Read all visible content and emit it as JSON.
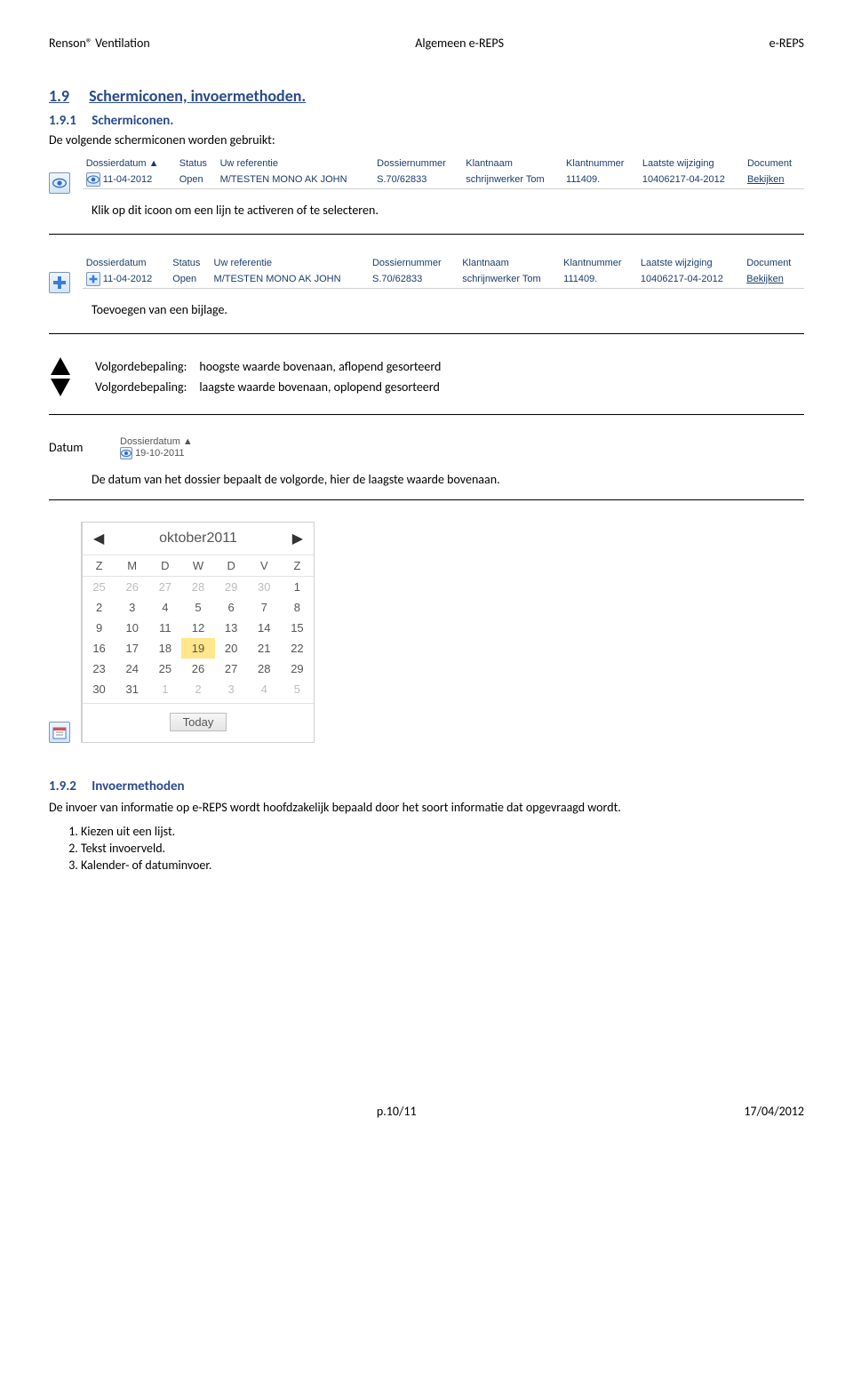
{
  "header": {
    "left": "Renson® Ventilation",
    "center": "Algemeen e-REPS",
    "right": "e-REPS"
  },
  "footer": {
    "center": "p.10/11",
    "right": "17/04/2012"
  },
  "section": {
    "num": "1.9",
    "title": "Schermiconen, invoermethoden."
  },
  "sub1": {
    "num": "1.9.1",
    "title": "Schermiconen."
  },
  "sub1desc": "De volgende schermiconen worden gebruikt:",
  "table1": {
    "headers": [
      "Dossierdatum ▲",
      "Status",
      "Uw referentie",
      "Dossiernummer",
      "Klantnaam",
      "Klantnummer",
      "Laatste wijziging",
      "Document"
    ],
    "row": [
      "11-04-2012",
      "Open",
      "M/TESTEN MONO AK JOHN",
      "S.70/62833",
      "schrijnwerker Tom",
      "111409.",
      "10406217-04-2012",
      "Bekijken"
    ]
  },
  "caption1": "Klik op dit icoon om een lijn te activeren of te selecteren.",
  "table2": {
    "headers": [
      "Dossierdatum",
      "Status",
      "Uw referentie",
      "Dossiernummer",
      "Klantnaam",
      "Klantnummer",
      "Laatste wijziging",
      "Document"
    ],
    "row": [
      "11-04-2012",
      "Open",
      "M/TESTEN MONO AK JOHN",
      "S.70/62833",
      "schrijnwerker Tom",
      "111409.",
      "10406217-04-2012",
      "Bekijken"
    ]
  },
  "caption2": "Toevoegen van een bijlage.",
  "sort": {
    "rows": [
      [
        "Volgordebepaling:",
        "hoogste waarde bovenaan, aflopend gesorteerd"
      ],
      [
        "Volgordebepaling:",
        "laagste waarde bovenaan, oplopend gesorteerd"
      ]
    ]
  },
  "datum": {
    "label": "Datum",
    "mini_header": "Dossierdatum ▲",
    "mini_value": "19-10-2011",
    "caption": "De datum van het dossier bepaalt de volgorde, hier de laagste waarde bovenaan."
  },
  "calendar": {
    "title": "oktober2011",
    "dow": [
      "Z",
      "M",
      "D",
      "W",
      "D",
      "V",
      "Z"
    ],
    "weeks": [
      [
        {
          "d": 25,
          "o": true
        },
        {
          "d": 26,
          "o": true
        },
        {
          "d": 27,
          "o": true
        },
        {
          "d": 28,
          "o": true
        },
        {
          "d": 29,
          "o": true
        },
        {
          "d": 30,
          "o": true
        },
        {
          "d": 1
        }
      ],
      [
        {
          "d": 2
        },
        {
          "d": 3
        },
        {
          "d": 4
        },
        {
          "d": 5
        },
        {
          "d": 6
        },
        {
          "d": 7
        },
        {
          "d": 8
        }
      ],
      [
        {
          "d": 9
        },
        {
          "d": 10
        },
        {
          "d": 11
        },
        {
          "d": 12
        },
        {
          "d": 13
        },
        {
          "d": 14
        },
        {
          "d": 15
        }
      ],
      [
        {
          "d": 16
        },
        {
          "d": 17
        },
        {
          "d": 18
        },
        {
          "d": 19,
          "sel": true
        },
        {
          "d": 20
        },
        {
          "d": 21
        },
        {
          "d": 22
        }
      ],
      [
        {
          "d": 23
        },
        {
          "d": 24
        },
        {
          "d": 25
        },
        {
          "d": 26
        },
        {
          "d": 27
        },
        {
          "d": 28
        },
        {
          "d": 29
        }
      ],
      [
        {
          "d": 30
        },
        {
          "d": 31
        },
        {
          "d": 1,
          "o": true
        },
        {
          "d": 2,
          "o": true
        },
        {
          "d": 3,
          "o": true
        },
        {
          "d": 4,
          "o": true
        },
        {
          "d": 5,
          "o": true
        }
      ]
    ],
    "today": "Today"
  },
  "sub2": {
    "num": "1.9.2",
    "title": "Invoermethoden"
  },
  "sub2desc": "De invoer van informatie op e-REPS wordt hoofdzakelijk bepaald door het soort informatie dat opgevraagd wordt.",
  "list": [
    "Kiezen uit een lijst.",
    "Tekst invoerveld.",
    "Kalender- of datuminvoer."
  ]
}
